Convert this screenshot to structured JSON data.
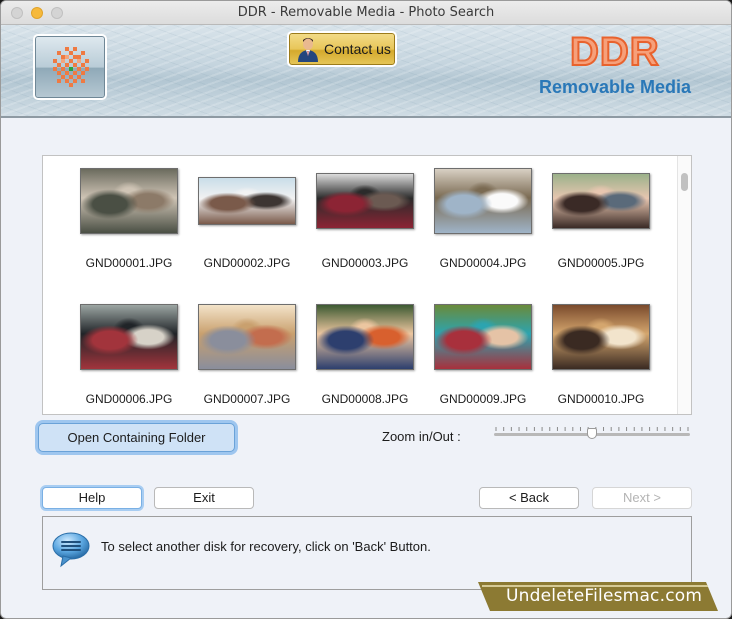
{
  "window": {
    "title": "DDR - Removable Media - Photo Search",
    "controls": [
      "close",
      "minimize",
      "maximize"
    ]
  },
  "header": {
    "logo_icon": "ddr-checker-logo-icon",
    "contact_button_label": "Contact us",
    "contact_icon": "support-person-icon",
    "brand_name": "DDR",
    "brand_subtitle": "Removable Media",
    "colors": {
      "brand_orange": "#e8622d",
      "brand_blue": "#2a78b8"
    }
  },
  "gallery": {
    "items": [
      {
        "name": "GND00001.JPG",
        "palette": [
          "#6b6b5e",
          "#cfc4b5",
          "#4a4f44",
          "#8c7a68"
        ]
      },
      {
        "name": "GND00002.JPG",
        "palette": [
          "#c9dde9",
          "#f2f2f2",
          "#7a5a4a",
          "#3d3532"
        ]
      },
      {
        "name": "GND00003.JPG",
        "palette": [
          "#dcdcdc",
          "#2b2b2b",
          "#8c2434",
          "#6b5a52"
        ]
      },
      {
        "name": "GND00004.JPG",
        "palette": [
          "#d8d0c4",
          "#7a6a52",
          "#9fb4c8",
          "#fafafa"
        ]
      },
      {
        "name": "GND00005.JPG",
        "palette": [
          "#9bb18a",
          "#e7c6b0",
          "#3a2a26",
          "#5a6a7a"
        ]
      },
      {
        "name": "GND00006.JPG",
        "palette": [
          "#9ca6a3",
          "#202428",
          "#a2343c",
          "#d7d2c8"
        ]
      },
      {
        "name": "GND00007.JPG",
        "palette": [
          "#f3e3c9",
          "#c9a06e",
          "#8a8e9c",
          "#c36d4e"
        ]
      },
      {
        "name": "GND00008.JPG",
        "palette": [
          "#3d5a32",
          "#ecc6a0",
          "#2d3f6e",
          "#d8602e"
        ]
      },
      {
        "name": "GND00009.JPG",
        "palette": [
          "#6a8a3a",
          "#2ca4b0",
          "#a8303c",
          "#e5c3a6"
        ]
      },
      {
        "name": "GND00010.JPG",
        "palette": [
          "#7a4a2c",
          "#d4a66e",
          "#3a2a22",
          "#f2e4cc"
        ]
      }
    ]
  },
  "actions": {
    "open_folder_label": "Open Containing Folder",
    "zoom_label": "Zoom in/Out :",
    "zoom_value_fraction": 0.5,
    "zoom_tick_count": 26
  },
  "nav": {
    "help_label": "Help",
    "exit_label": "Exit",
    "back_label": "< Back",
    "next_label": "Next >",
    "next_enabled": false
  },
  "info": {
    "icon": "speech-bubble-icon",
    "message": "To select another disk for recovery, click on 'Back' Button."
  },
  "watermark": {
    "text": "UndeleteFilesmac.com",
    "color": "#8c7a33"
  }
}
